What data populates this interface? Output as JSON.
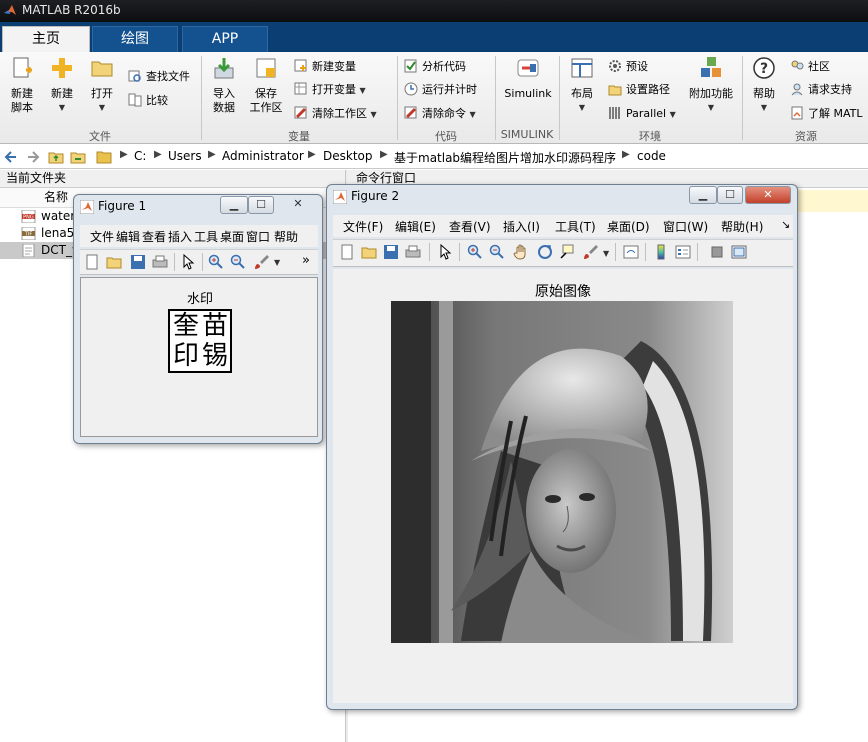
{
  "app": {
    "title": "MATLAB R2016b"
  },
  "tabs": [
    {
      "label": "主页",
      "active": true
    },
    {
      "label": "绘图",
      "active": false
    },
    {
      "label": "APP",
      "active": false
    }
  ],
  "ribbon": {
    "file": {
      "group": "文件",
      "new_script": "新建\n脚本",
      "new": "新建",
      "open": "打开",
      "find_files": "查找文件",
      "compare": "比较"
    },
    "variable": {
      "group": "变量",
      "import": "导入\n数据",
      "save_ws": "保存\n工作区",
      "new_var": "新建变量",
      "open_var": "打开变量",
      "clear_ws": "清除工作区"
    },
    "code": {
      "group": "代码",
      "analyze": "分析代码",
      "run_time": "运行并计时",
      "clear_cmd": "清除命令"
    },
    "simulink": {
      "group": "SIMULINK",
      "label": "Simulink"
    },
    "env": {
      "group": "环境",
      "layout": "布局",
      "prefs": "预设",
      "set_path": "设置路径",
      "parallel": "Parallel",
      "addons": "附加功能"
    },
    "resources": {
      "group": "资源",
      "help": "帮助",
      "community": "社区",
      "support": "请求支持",
      "learn": "了解 MATL"
    }
  },
  "address": {
    "segments": [
      "C:",
      "Users",
      "Administrator",
      "Desktop",
      "基于matlab编程给图片增加水印源码程序",
      "code"
    ]
  },
  "current_folder": {
    "header": "当前文件夹",
    "col_name": "名称",
    "files": [
      {
        "name": "water",
        "type": "png"
      },
      {
        "name": "lena5",
        "type": "tif"
      },
      {
        "name": "DCT_w",
        "type": "m",
        "selected": true
      }
    ]
  },
  "command_window": {
    "header": "命令行窗口"
  },
  "figure1": {
    "title": "Figure 1",
    "menus": [
      "文件",
      "编辑",
      "查看",
      "插入",
      "工具",
      "桌面",
      "窗口",
      "帮助"
    ],
    "axes_title": "水印",
    "watermark_chars": [
      "奎",
      "苗",
      "印",
      "锡"
    ],
    "more": "»"
  },
  "figure2": {
    "title": "Figure 2",
    "menus": [
      "文件(F)",
      "编辑(E)",
      "查看(V)",
      "插入(I)",
      "工具(T)",
      "桌面(D)",
      "窗口(W)",
      "帮助(H)"
    ],
    "axes_title": "原始图像"
  },
  "colors": {
    "tabstrip": "#0b3f74",
    "titlebar": "#0d0e10",
    "figframe": "#dfe6ee"
  }
}
